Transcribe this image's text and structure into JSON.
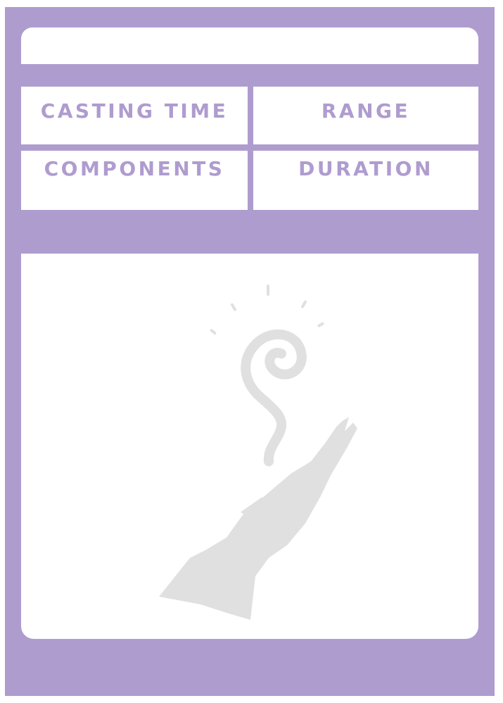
{
  "card": {
    "accent_color": "#af9ccf",
    "art_color": "#e0e0e0"
  },
  "stats": {
    "casting_time_label": "CASTING TIME",
    "range_label": "RANGE",
    "components_label": "COMPONENTS",
    "duration_label": "DURATION"
  },
  "illustration": {
    "icon": "casting-hand-icon"
  }
}
